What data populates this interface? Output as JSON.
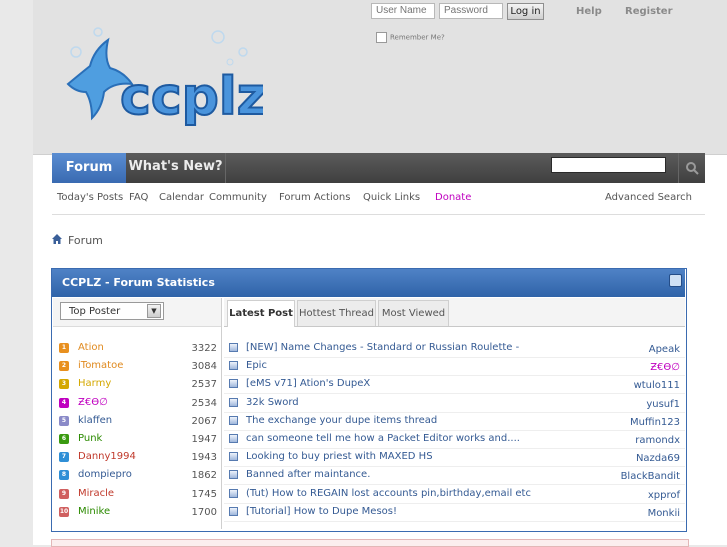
{
  "header": {
    "username_placeholder": "User Name",
    "password_placeholder": "Password",
    "login_label": "Log in",
    "remember_label": "Remember Me?",
    "help_label": "Help",
    "register_label": "Register",
    "logo_text": "ccplz"
  },
  "navbar": {
    "tabs": [
      {
        "label": "Forum"
      },
      {
        "label": "What's New?"
      }
    ]
  },
  "subnav": {
    "items": [
      {
        "label": "Today's Posts"
      },
      {
        "label": "FAQ"
      },
      {
        "label": "Calendar"
      },
      {
        "label": "Community"
      },
      {
        "label": "Forum Actions"
      },
      {
        "label": "Quick Links"
      },
      {
        "label": "Donate"
      },
      {
        "label": "Advanced Search"
      }
    ]
  },
  "breadcrumb": {
    "label": "Forum"
  },
  "stats": {
    "title": "CCPLZ - Forum Statistics",
    "select_value": "Top Poster",
    "posters": [
      {
        "rank": "1",
        "name": "Ation",
        "count": "3322",
        "color": "#e08a1f",
        "badge": "#e8901f"
      },
      {
        "rank": "2",
        "name": "iTomatoe",
        "count": "3084",
        "color": "#e08a1f",
        "badge": "#e8901f"
      },
      {
        "rank": "3",
        "name": "Harmy",
        "count": "2537",
        "color": "#d4a800",
        "badge": "#d4a800"
      },
      {
        "rank": "4",
        "name": "Ƶ€Ɵ∅",
        "count": "2534",
        "color": "#c000c0",
        "badge": "#c000c0"
      },
      {
        "rank": "5",
        "name": "klaffen",
        "count": "2067",
        "color": "#345a93",
        "badge": "#8a8ac8"
      },
      {
        "rank": "6",
        "name": "Punk",
        "count": "1947",
        "color": "#2b8a00",
        "badge": "#3a9a10"
      },
      {
        "rank": "7",
        "name": "Danny1994",
        "count": "1943",
        "color": "#c0392b",
        "badge": "#2f8fd6"
      },
      {
        "rank": "8",
        "name": "dompiepro",
        "count": "1862",
        "color": "#345a93",
        "badge": "#2f8fd6"
      },
      {
        "rank": "9",
        "name": "Miracle",
        "count": "1745",
        "color": "#c0392b",
        "badge": "#d06060"
      },
      {
        "rank": "10",
        "name": "Minike",
        "count": "1700",
        "color": "#2b8a00",
        "badge": "#d06060"
      }
    ],
    "tabs": [
      {
        "label": "Latest Post"
      },
      {
        "label": "Hottest Thread"
      },
      {
        "label": "Most Viewed"
      }
    ],
    "threads": [
      {
        "title": "[NEW] Name Changes - Standard or Russian Roulette -",
        "user": "Apeak",
        "user_color": "#345a93"
      },
      {
        "title": "Epic",
        "user": "Ƶ€Ɵ∅",
        "user_color": "#c000c0"
      },
      {
        "title": "[eMS v71] Ation's DupeX",
        "user": "wtulo111",
        "user_color": "#345a93"
      },
      {
        "title": "32k Sword",
        "user": "yusuf1",
        "user_color": "#345a93"
      },
      {
        "title": "The exchange your dupe items thread",
        "user": "Muffin123",
        "user_color": "#345a93"
      },
      {
        "title": "can someone tell me how a Packet Editor works and....",
        "user": "ramondx",
        "user_color": "#345a93"
      },
      {
        "title": "Looking to buy priest with MAXED HS",
        "user": "Nazda69",
        "user_color": "#345a93"
      },
      {
        "title": "Banned after maintance.",
        "user": "BlackBandit",
        "user_color": "#345a93"
      },
      {
        "title": "(Tut) How to REGAIN lost accounts pin,birthday,email etc",
        "user": "xpprof",
        "user_color": "#345a93"
      },
      {
        "title": "[Tutorial] How to Dupe Mesos!",
        "user": "Monkii",
        "user_color": "#345a93"
      }
    ]
  }
}
